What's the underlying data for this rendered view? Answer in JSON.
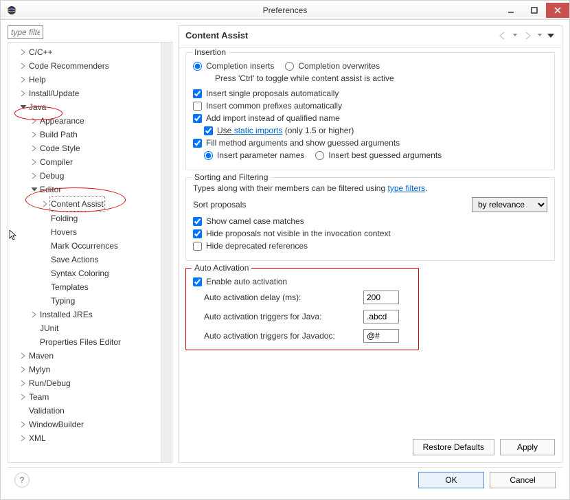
{
  "window": {
    "title": "Preferences"
  },
  "filter_placeholder": "type filter text",
  "tree": {
    "cpp": "C/C++",
    "coderec": "Code Recommenders",
    "help": "Help",
    "install": "Install/Update",
    "java": "Java",
    "appearance": "Appearance",
    "buildpath": "Build Path",
    "codestyle": "Code Style",
    "compiler": "Compiler",
    "debug": "Debug",
    "editor": "Editor",
    "contentassist": "Content Assist",
    "folding": "Folding",
    "hovers": "Hovers",
    "markocc": "Mark Occurrences",
    "saveactions": "Save Actions",
    "syntax": "Syntax Coloring",
    "templates": "Templates",
    "typing": "Typing",
    "jres": "Installed JREs",
    "junit": "JUnit",
    "propfiles": "Properties Files Editor",
    "maven": "Maven",
    "mylyn": "Mylyn",
    "rundebug": "Run/Debug",
    "team": "Team",
    "validation": "Validation",
    "windowbuilder": "WindowBuilder",
    "xml": "XML"
  },
  "page": {
    "title": "Content Assist",
    "insertion": {
      "title": "Insertion",
      "comp_inserts": "Completion inserts",
      "comp_overwrites": "Completion overwrites",
      "ctrl_hint": "Press 'Ctrl' to toggle while content assist is active",
      "insert_single": "Insert single proposals automatically",
      "insert_common": "Insert common prefixes automatically",
      "add_import": "Add import instead of qualified name",
      "use_static_pre": "Use ",
      "use_static_link": "static imports",
      "use_static_post": " (only 1.5 or higher)",
      "fill_method": "Fill method arguments and show guessed arguments",
      "insert_param": "Insert parameter names",
      "insert_best": "Insert best guessed arguments"
    },
    "sorting": {
      "title": "Sorting and Filtering",
      "types_hint_pre": "Types along with their members can be filtered using ",
      "types_hint_link": "type filters",
      "types_hint_post": ".",
      "sort_proposals": "Sort proposals",
      "by_relevance": "by relevance",
      "camel": "Show camel case matches",
      "hide_not_visible": "Hide proposals not visible in the invocation context",
      "hide_deprecated": "Hide deprecated references"
    },
    "auto": {
      "title": "Auto Activation",
      "enable": "Enable auto activation",
      "delay_label": "Auto activation delay (ms):",
      "delay_value": "200",
      "triggers_java_label": "Auto activation triggers for Java:",
      "triggers_java_value": ".abcd",
      "triggers_javadoc_label": "Auto activation triggers for Javadoc:",
      "triggers_javadoc_value": "@#"
    },
    "restore": "Restore Defaults",
    "apply": "Apply"
  },
  "footer": {
    "ok": "OK",
    "cancel": "Cancel"
  }
}
